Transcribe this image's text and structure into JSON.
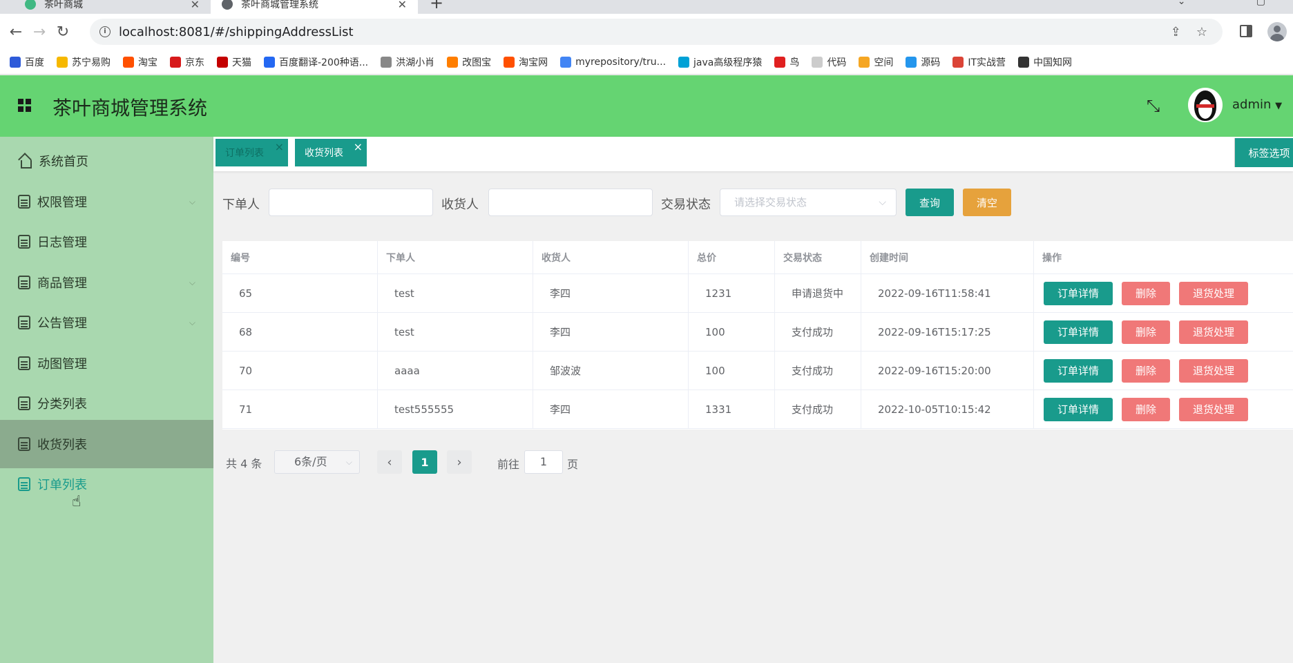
{
  "browser": {
    "tabs": [
      {
        "title": "茶叶商城"
      },
      {
        "title": "茶叶商城管理系统"
      }
    ],
    "url": "localhost:8081/#/shippingAddressList",
    "bookmarks": [
      {
        "label": "百度",
        "icon": "baidu-icon",
        "color": "#2e5bd9"
      },
      {
        "label": "苏宁易购",
        "icon": "suning-icon",
        "color": "#f6b800"
      },
      {
        "label": "淘宝",
        "icon": "taobao-icon",
        "color": "#ff5000"
      },
      {
        "label": "京东",
        "icon": "jd-icon",
        "color": "#d71a1b"
      },
      {
        "label": "天猫",
        "icon": "tmall-icon",
        "color": "#c40000"
      },
      {
        "label": "百度翻译-200种语...",
        "icon": "translate-icon",
        "color": "#2468f2"
      },
      {
        "label": "洪湖小肖",
        "icon": "bird-icon",
        "color": "#888888"
      },
      {
        "label": "改图宝",
        "icon": "image-icon",
        "color": "#ff7e00"
      },
      {
        "label": "淘宝网",
        "icon": "taobao-icon",
        "color": "#ff5000"
      },
      {
        "label": "myrepository/tru...",
        "icon": "chrome-icon",
        "color": "#4285f4"
      },
      {
        "label": "java高级程序猿",
        "icon": "bilibili-icon",
        "color": "#00a1d6"
      },
      {
        "label": "鸟",
        "icon": "bird-icon",
        "color": "#e02020"
      },
      {
        "label": "代码",
        "icon": "code-icon",
        "color": "#cccccc"
      },
      {
        "label": "空间",
        "icon": "space-icon",
        "color": "#f5a623"
      },
      {
        "label": "源码",
        "icon": "docker-icon",
        "color": "#2496ed"
      },
      {
        "label": "IT实战营",
        "icon": "chrome-icon",
        "color": "#db4437"
      },
      {
        "label": "中国知网",
        "icon": "cnki-icon",
        "color": "#333333"
      }
    ]
  },
  "header": {
    "title": "茶叶商城管理系统",
    "user": "admin"
  },
  "sidebar": {
    "items": [
      {
        "label": "系统首页",
        "expandable": false
      },
      {
        "label": "权限管理",
        "expandable": true
      },
      {
        "label": "日志管理",
        "expandable": false
      },
      {
        "label": "商品管理",
        "expandable": true
      },
      {
        "label": "公告管理",
        "expandable": true
      },
      {
        "label": "动图管理",
        "expandable": false
      },
      {
        "label": "分类列表",
        "expandable": false
      },
      {
        "label": "收货列表",
        "expandable": false
      },
      {
        "label": "订单列表",
        "expandable": false
      }
    ]
  },
  "tags": {
    "items": [
      {
        "label": "订单列表"
      },
      {
        "label": "收货列表"
      }
    ],
    "options_label": "标签选项"
  },
  "search": {
    "buyer_label": "下单人",
    "receiver_label": "收货人",
    "status_label": "交易状态",
    "status_placeholder": "请选择交易状态",
    "query_button": "查询",
    "clear_button": "清空"
  },
  "table": {
    "headers": [
      "编号",
      "下单人",
      "收货人",
      "总价",
      "交易状态",
      "创建时间",
      "操作"
    ],
    "rows": [
      {
        "id": "65",
        "buyer": "test",
        "receiver": "李四",
        "total": "1231",
        "status": "申请退货中",
        "created": "2022-09-16T11:58:41"
      },
      {
        "id": "68",
        "buyer": "test",
        "receiver": "李四",
        "total": "100",
        "status": "支付成功",
        "created": "2022-09-16T15:17:25"
      },
      {
        "id": "70",
        "buyer": "aaaa",
        "receiver": "邹波波",
        "total": "100",
        "status": "支付成功",
        "created": "2022-09-16T15:20:00"
      },
      {
        "id": "71",
        "buyer": "test555555",
        "receiver": "李四",
        "total": "1331",
        "status": "支付成功",
        "created": "2022-10-05T10:15:42"
      }
    ],
    "actions": {
      "detail": "订单详情",
      "delete": "删除",
      "return": "退货处理"
    }
  },
  "pagination": {
    "total": "共 4 条",
    "page_size": "6条/页",
    "current_page": "1",
    "goto_label": "前往",
    "goto_value": "1",
    "page_suffix": "页"
  },
  "colors": {
    "header_bg": "#65d472",
    "sidebar_bg": "#a9d8af",
    "primary": "#199b8c",
    "danger": "#f07878",
    "warning": "#e6a23c"
  }
}
